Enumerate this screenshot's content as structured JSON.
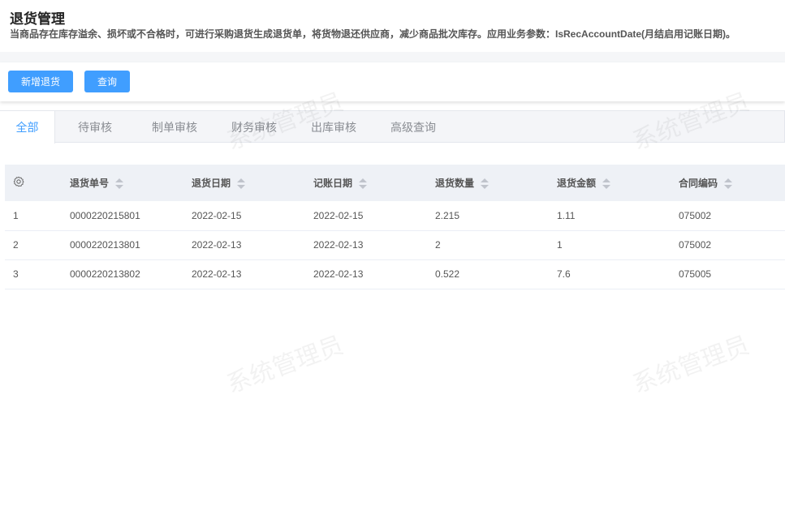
{
  "header": {
    "title": "退货管理",
    "description": "当商品存在库存溢余、损坏或不合格时，可进行采购退货生成退货单，将货物退还供应商，减少商品批次库存。应用业务参数：IsRecAccountDate(月结启用记账日期)。"
  },
  "toolbar": {
    "add_label": "新增退货",
    "query_label": "查询"
  },
  "tabs": [
    {
      "label": "全部"
    },
    {
      "label": "待审核"
    },
    {
      "label": "制单审核"
    },
    {
      "label": "财务审核"
    },
    {
      "label": "出库审核"
    },
    {
      "label": "高级查询"
    }
  ],
  "table": {
    "columns": [
      "退货单号",
      "退货日期",
      "记账日期",
      "退货数量",
      "退货金额",
      "合同编码"
    ],
    "rows": [
      [
        "1",
        "0000220215801",
        "2022-02-15",
        "2022-02-15",
        "2.215",
        "1.11",
        "075002"
      ],
      [
        "2",
        "0000220213801",
        "2022-02-13",
        "2022-02-13",
        "2",
        "1",
        "075002"
      ],
      [
        "3",
        "0000220213802",
        "2022-02-13",
        "2022-02-13",
        "0.522",
        "7.6",
        "075005"
      ]
    ]
  },
  "watermark": "系统管理员"
}
